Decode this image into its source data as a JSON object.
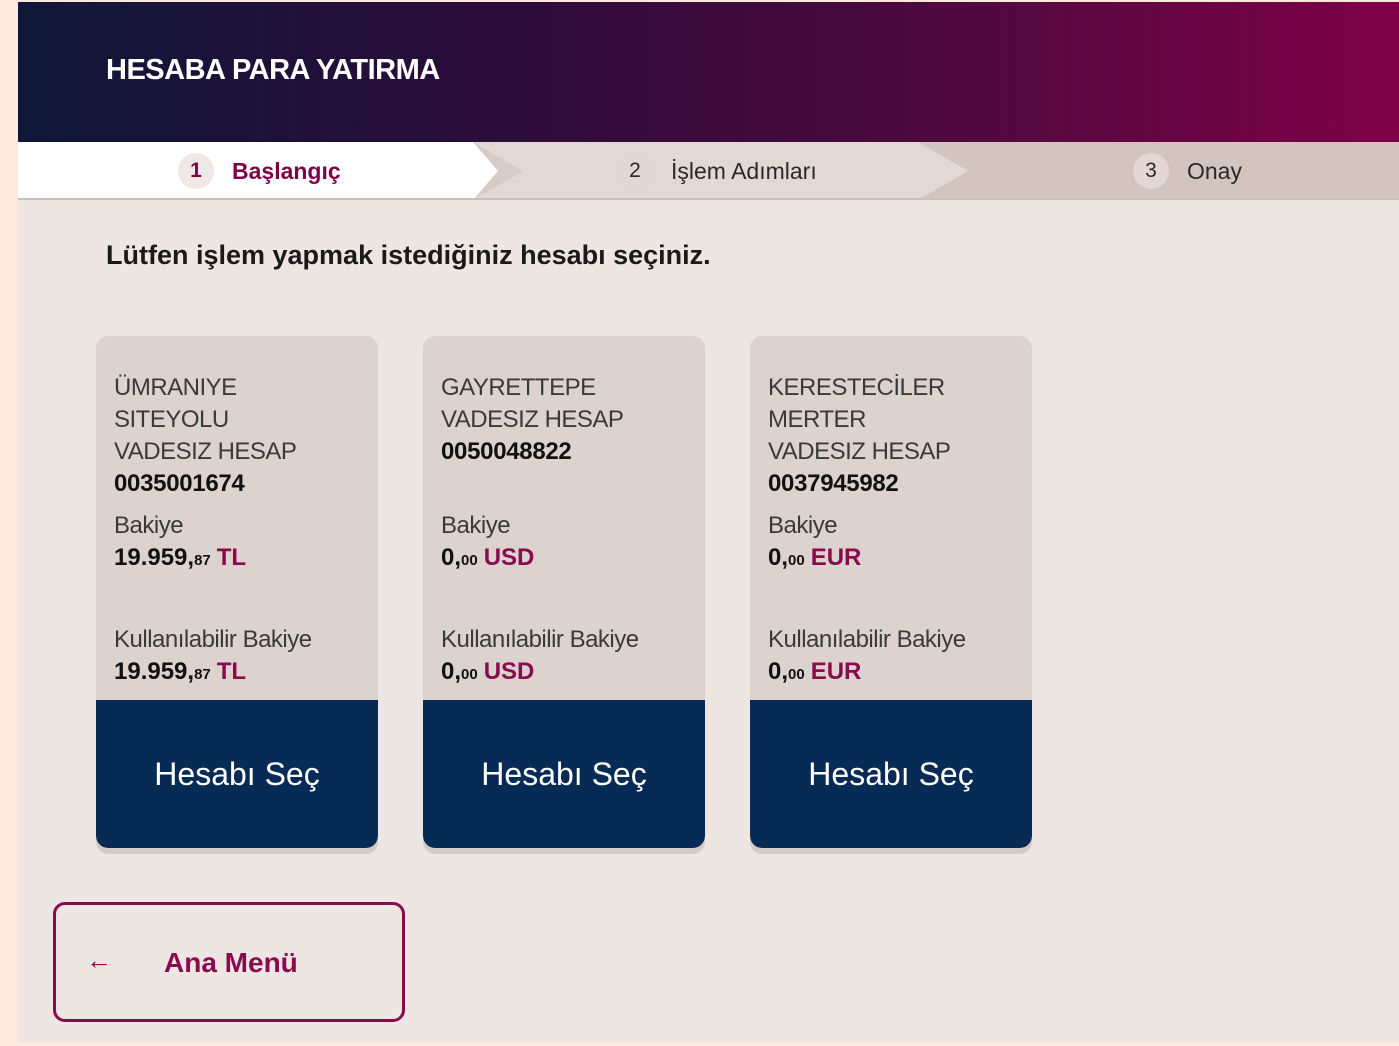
{
  "header": {
    "title": "HESABA PARA YATIRMA"
  },
  "steps": [
    {
      "number": "1",
      "label": "Başlangıç",
      "active": true
    },
    {
      "number": "2",
      "label": "İşlem Adımları",
      "active": false
    },
    {
      "number": "3",
      "label": "Onay",
      "active": false
    }
  ],
  "instruction": "Lütfen işlem yapmak istediğiniz hesabı seçiniz.",
  "accounts": [
    {
      "name_lines": [
        "ÜMRANIYE",
        "SITEYOLU",
        "VADESIZ HESAP"
      ],
      "account_number": "0035001674",
      "balance_label": "Bakiye",
      "balance_int": "19.959,",
      "balance_dec": "87",
      "balance_currency": "TL",
      "available_label": "Kullanılabilir Bakiye",
      "available_int": "19.959,",
      "available_dec": "87",
      "available_currency": "TL",
      "button_label": "Hesabı Seç"
    },
    {
      "name_lines": [
        "GAYRETTEPE",
        "VADESIZ HESAP"
      ],
      "account_number": "0050048822",
      "balance_label": "Bakiye",
      "balance_int": "0,",
      "balance_dec": "00",
      "balance_currency": "USD",
      "available_label": "Kullanılabilir Bakiye",
      "available_int": "0,",
      "available_dec": "00",
      "available_currency": "USD",
      "button_label": "Hesabı Seç"
    },
    {
      "name_lines": [
        "KERESTECİLER",
        "MERTER",
        "VADESIZ HESAP"
      ],
      "account_number": "0037945982",
      "balance_label": "Bakiye",
      "balance_int": "0,",
      "balance_dec": "00",
      "balance_currency": "EUR",
      "available_label": "Kullanılabilir Bakiye",
      "available_int": "0,",
      "available_dec": "00",
      "available_currency": "EUR",
      "button_label": "Hesabı Seç"
    }
  ],
  "footer": {
    "back_arrow": "←",
    "back_icon": "arrow-left-icon",
    "back_label": "Ana Menü"
  },
  "colors": {
    "accent": "#8a0a4f",
    "button": "#082b55",
    "header_start": "#0f1738",
    "header_end": "#7e0047"
  }
}
